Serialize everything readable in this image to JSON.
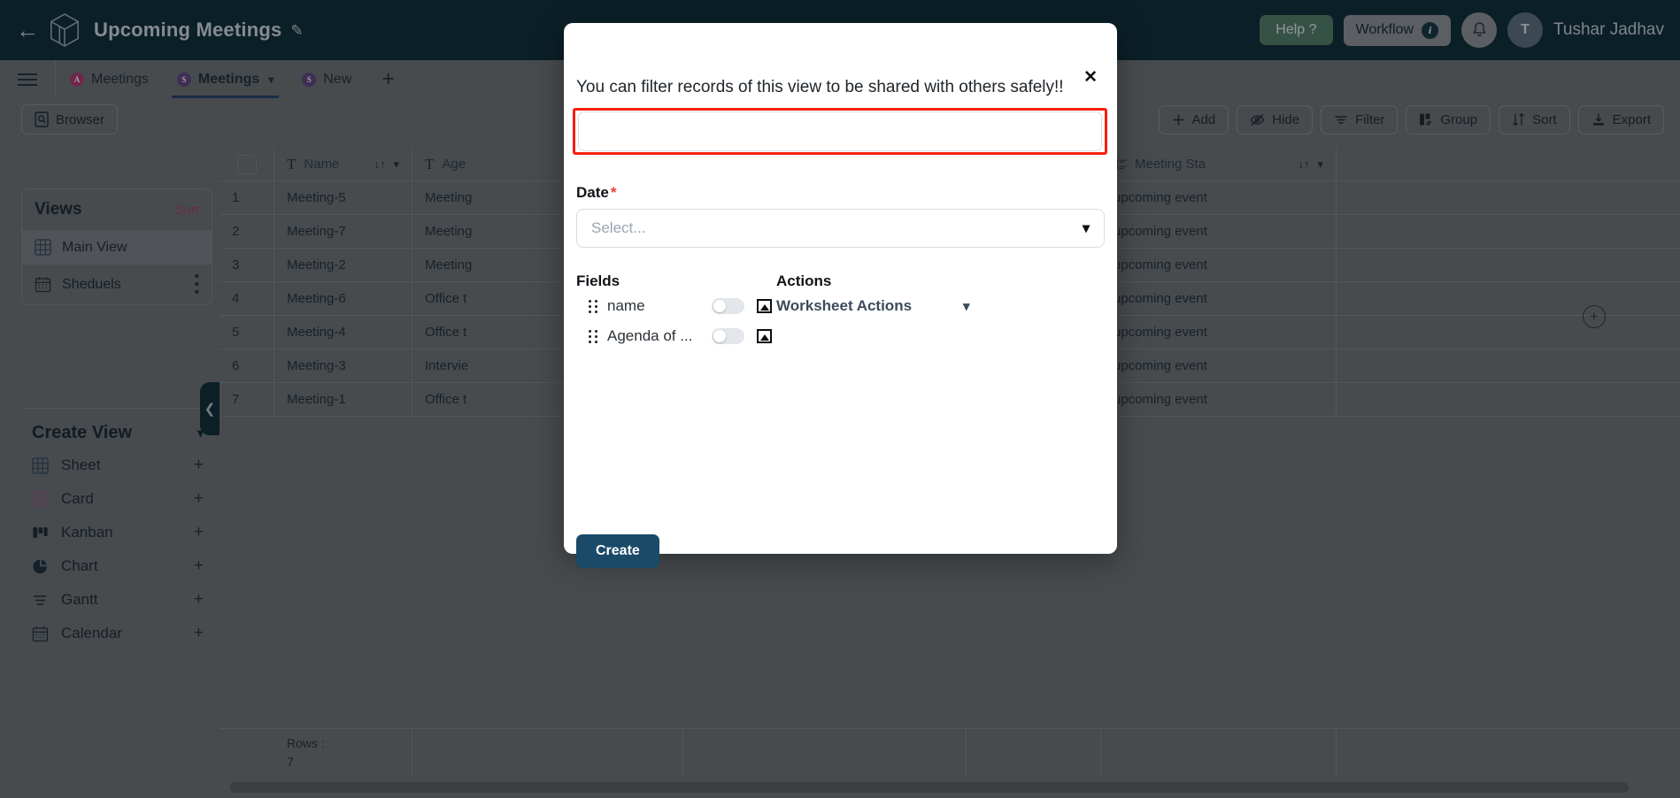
{
  "header": {
    "back_icon": "back-arrow-icon",
    "logo_icon": "cube-logo-icon",
    "title": "Upcoming Meetings",
    "edit_icon": "pencil-icon",
    "help_label": "Help ?",
    "workflow_label": "Workflow",
    "workflow_badge": "i",
    "bell_icon": "bell-icon",
    "avatar_initial": "T",
    "user_name": "Tushar Jadhav",
    "bg_color": "#05242e",
    "help_color": "#4e7a63"
  },
  "tabs": {
    "menu_icon": "hamburger-icon",
    "items": [
      {
        "badge": "A",
        "badge_color": "pink",
        "label": "Meetings",
        "active": false,
        "caret": false
      },
      {
        "badge": "S",
        "badge_color": "purple",
        "label": "Meetings",
        "active": true,
        "caret": true
      },
      {
        "badge": "S",
        "badge_color": "purple",
        "label": "New",
        "active": false,
        "caret": false
      }
    ],
    "add_tab_label": "+"
  },
  "toolbar": {
    "browser_label": "Browser",
    "browser_icon": "browser-icon",
    "right_buttons": [
      {
        "label": "Add",
        "icon": "plus-icon"
      },
      {
        "label": "Hide",
        "icon": "eye-off-icon"
      },
      {
        "label": "Filter",
        "icon": "filter-icon"
      },
      {
        "label": "Group",
        "icon": "group-icon"
      },
      {
        "label": "Sort",
        "icon": "sort-icon"
      },
      {
        "label": "Export",
        "icon": "download-icon"
      }
    ]
  },
  "sidebar": {
    "views_title": "Views",
    "sort_label": "Sort",
    "views": [
      {
        "label": "Main View",
        "icon": "grid-icon",
        "selected": true,
        "kebab": false
      },
      {
        "label": "Sheduels",
        "icon": "calendar-icon",
        "selected": false,
        "kebab": true
      }
    ],
    "create_view_title": "Create View",
    "create_view_caret": "chevron-down-icon",
    "create_view_items": [
      {
        "label": "Sheet",
        "icon": "sheet-icon",
        "add": "+"
      },
      {
        "label": "Card",
        "icon": "card-icon",
        "add": "+"
      },
      {
        "label": "Kanban",
        "icon": "kanban-icon",
        "add": "+"
      },
      {
        "label": "Chart",
        "icon": "chart-pie-icon",
        "add": "+"
      },
      {
        "label": "Gantt",
        "icon": "gantt-icon",
        "add": "+"
      },
      {
        "label": "Calendar",
        "icon": "calendar-icon",
        "add": "+"
      }
    ],
    "collapse_icon": "chevron-left-icon"
  },
  "grid": {
    "columns": [
      {
        "label": "",
        "type_icon": "checkbox"
      },
      {
        "label": "",
        "type_icon": ""
      },
      {
        "label": "Name",
        "type_icon": "T"
      },
      {
        "label": "Age",
        "type_icon": "T"
      },
      {
        "label": "",
        "type_icon": ""
      },
      {
        "label": "",
        "type_icon": ""
      },
      {
        "label": "Meeting Sta",
        "type_icon": "list-icon"
      },
      {
        "label": "",
        "type_icon": ""
      }
    ],
    "rows": [
      {
        "index": "1",
        "name": "Meeting-5",
        "agenda": "Meeting",
        "status": "upcoming event"
      },
      {
        "index": "2",
        "name": "Meeting-7",
        "agenda": "Meeting",
        "status": "upcoming event"
      },
      {
        "index": "3",
        "name": "Meeting-2",
        "agenda": "Meeting",
        "status": "upcoming event"
      },
      {
        "index": "4",
        "name": "Meeting-6",
        "agenda": "Office t",
        "status": "upcoming event"
      },
      {
        "index": "5",
        "name": "Meeting-4",
        "agenda": "Office t",
        "status": "upcoming event"
      },
      {
        "index": "6",
        "name": "Meeting-3",
        "agenda": "Intervie",
        "status": "upcoming event"
      },
      {
        "index": "7",
        "name": "Meeting-1",
        "agenda": "Office t",
        "status": "upcoming event"
      }
    ],
    "footer_label": "Rows :",
    "footer_count": "7",
    "add_column_icon": "plus-circle-icon"
  },
  "modal": {
    "heading": "You can filter records of this view to be shared with others safely!!",
    "close_icon": "close-icon",
    "title_input_value": "",
    "title_input_placeholder": "",
    "highlight_color": "#f61f0e",
    "date_label": "Date",
    "date_required": "*",
    "date_placeholder": "Select...",
    "date_caret": "chevron-down-icon",
    "fields_title": "Fields",
    "actions_title": "Actions",
    "fields": [
      {
        "name": "name",
        "toggle": "off",
        "image_icon": "image-icon",
        "drag_icon": "drag-handle-icon"
      },
      {
        "name": "Agenda of ...",
        "toggle": "off",
        "image_icon": "image-icon",
        "drag_icon": "drag-handle-icon"
      }
    ],
    "worksheet_actions_label": "Worksheet Actions",
    "worksheet_actions_caret": "chevron-down-icon",
    "create_label": "Create",
    "create_color": "#1b4a69"
  }
}
